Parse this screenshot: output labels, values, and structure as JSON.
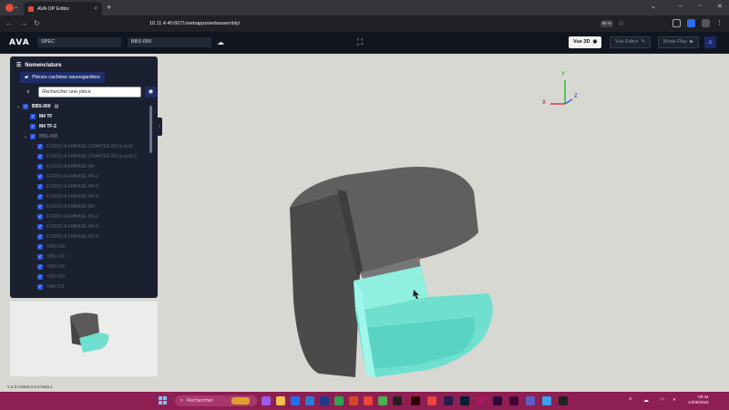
{
  "browser": {
    "tab_title": "AVA OP Editor",
    "tab_close": "×",
    "new_tab": "+",
    "url": "10.11.4.40:6071/webapps/webassembly/",
    "zoom": "90 %",
    "back_icon": "arrow-left-icon",
    "forward_icon": "arrow-right-icon",
    "reload_icon": "reload-icon"
  },
  "app": {
    "logo": "AVA",
    "field_spec": "SPEC",
    "field_ref": "BBS-000",
    "btn_vue3d": "Vue 3D",
    "btn_vue_editor": "Vue Editor",
    "btn_mode_play": "Mode Play",
    "version": "V.2.0.0-beta.8-2.0-beta.1"
  },
  "panel": {
    "title": "Nomenclature",
    "saved_button": "Pièces cachées sauvegardées",
    "search_placeholder": "Rechercher une pièce",
    "tree": [
      {
        "label": "BBS-000",
        "level": 0,
        "style": "bold",
        "arrow": "⌄",
        "doc": true
      },
      {
        "label": "M4 TF",
        "level": 1,
        "style": "bold",
        "arrow": ""
      },
      {
        "label": "M4 TF-2",
        "level": 1,
        "style": "bold",
        "arrow": ""
      },
      {
        "label": "BBS-008",
        "level": 1,
        "style": "dim",
        "arrow": "⌄"
      },
      {
        "label": "ECROU A EMBASE CRANTEE M3 (Local)",
        "level": 2,
        "style": "faded",
        "arrow": ""
      },
      {
        "label": "ECROU A EMBASE CRANTEE M3 (Local)-2",
        "level": 2,
        "style": "faded",
        "arrow": ""
      },
      {
        "label": "ECROU A EMBASE M4",
        "level": 2,
        "style": "faded",
        "arrow": ""
      },
      {
        "label": "ECROU A EMBASE M4-2",
        "level": 2,
        "style": "faded",
        "arrow": ""
      },
      {
        "label": "ECROU A EMBASE M4-3",
        "level": 2,
        "style": "faded",
        "arrow": ""
      },
      {
        "label": "ECROU A EMBASE M4-4",
        "level": 2,
        "style": "faded",
        "arrow": ""
      },
      {
        "label": "ECROU A EMBASE M3",
        "level": 2,
        "style": "faded",
        "arrow": ""
      },
      {
        "label": "ECROU A EMBASE M3-2",
        "level": 2,
        "style": "faded",
        "arrow": ""
      },
      {
        "label": "ECROU A EMBASE M3-3",
        "level": 2,
        "style": "faded",
        "arrow": ""
      },
      {
        "label": "ECROU A EMBASE M3-4",
        "level": 2,
        "style": "faded",
        "arrow": ""
      },
      {
        "label": "VBS-019",
        "level": 2,
        "style": "faded",
        "arrow": ""
      },
      {
        "label": "VBS-018",
        "level": 2,
        "style": "faded",
        "arrow": ""
      },
      {
        "label": "VBS-016",
        "level": 2,
        "style": "faded",
        "arrow": ""
      },
      {
        "label": "VBS-020",
        "level": 2,
        "style": "faded",
        "arrow": ""
      },
      {
        "label": "VBS-021",
        "level": 2,
        "style": "faded",
        "arrow": ""
      },
      {
        "label": "VBS-022",
        "level": 2,
        "style": "faded",
        "arrow": ""
      }
    ]
  },
  "axes": {
    "x": "X",
    "y": "Y",
    "z": "Z"
  },
  "taskbar": {
    "search": "Rechercher",
    "time": "09:44",
    "date": "14/06/2023"
  },
  "colors": {
    "panel_bg": "#1a2030",
    "accent_blue": "#2c56d6",
    "highlight_part": "#6fe8d6",
    "taskbar": "#8e1f53"
  }
}
